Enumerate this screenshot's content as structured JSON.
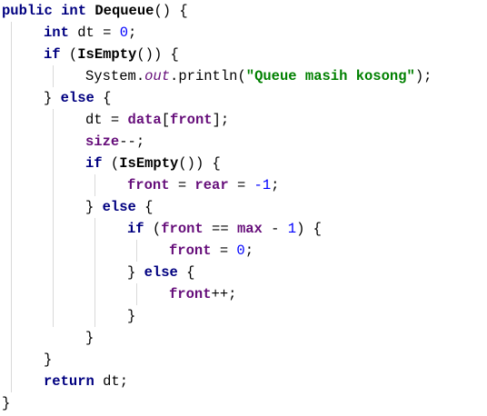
{
  "code": {
    "kw_public": "public",
    "kw_int": "int",
    "method_name": "Dequeue",
    "kw_if": "if",
    "kw_else": "else",
    "kw_return": "return",
    "var_dt": "dt",
    "num_zero": "0",
    "num_one": "1",
    "num_neg_one": "-1",
    "is_empty": "IsEmpty",
    "system": "System",
    "out": "out",
    "println": "println",
    "message": "\"Queue masih kosong\"",
    "data": "data",
    "front": "front",
    "size": "size",
    "rear": "rear",
    "max": "max"
  }
}
